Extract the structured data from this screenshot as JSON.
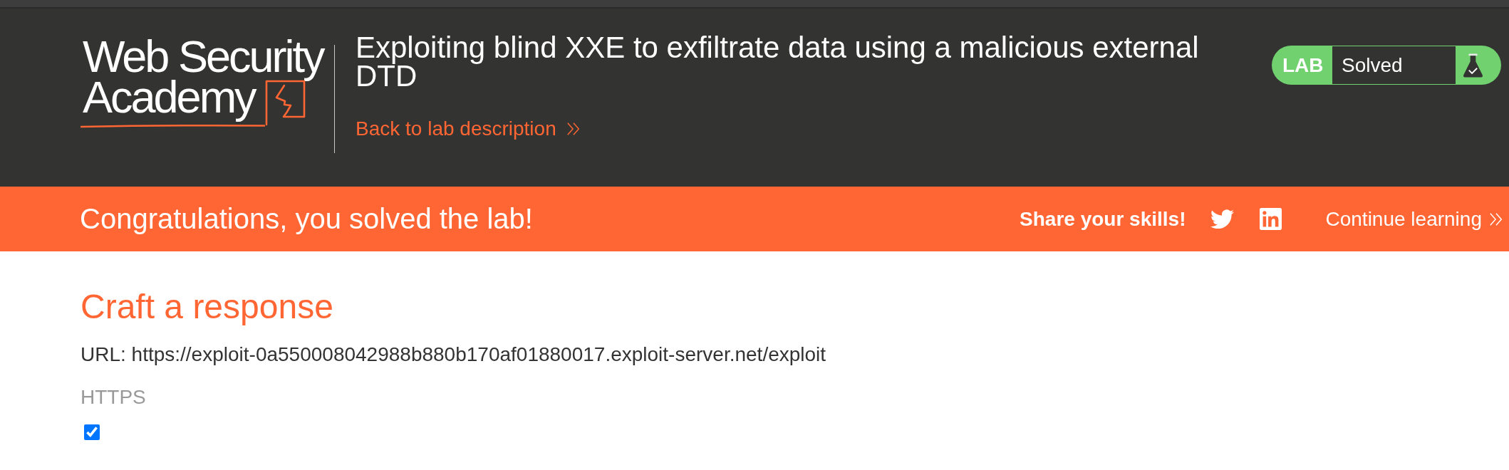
{
  "header": {
    "logo": {
      "line_1": "Web Security",
      "line_2": "Academy"
    },
    "title": "Exploiting blind XXE to exfiltrate data using a malicious external DTD",
    "back_link": "Back to lab description",
    "lab_status": {
      "label": "LAB",
      "status": "Solved",
      "solved": true
    }
  },
  "notification": {
    "message": "Congratulations, you solved the lab!",
    "share_label": "Share your skills!",
    "share_links": [
      {
        "kind": "twitter"
      },
      {
        "kind": "linkedin"
      }
    ],
    "continue_link": "Continue learning"
  },
  "form": {
    "heading": "Craft a response",
    "url": "URL: https://exploit-0a550008042988b880b170af01880017.exploit-server.net/exploit",
    "options": [
      {
        "label": "HTTPS",
        "checked": true
      }
    ]
  }
}
